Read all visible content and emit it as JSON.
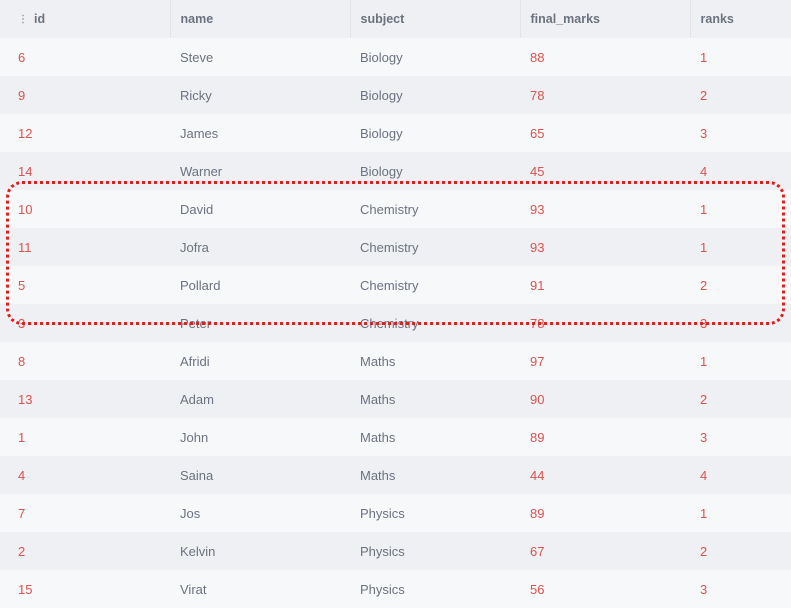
{
  "columns": {
    "id": "id",
    "name": "name",
    "subject": "subject",
    "final_marks": "final_marks",
    "ranks": "ranks"
  },
  "rows": [
    {
      "id": "6",
      "name": "Steve",
      "subject": "Biology",
      "final_marks": "88",
      "ranks": "1"
    },
    {
      "id": "9",
      "name": "Ricky",
      "subject": "Biology",
      "final_marks": "78",
      "ranks": "2"
    },
    {
      "id": "12",
      "name": "James",
      "subject": "Biology",
      "final_marks": "65",
      "ranks": "3"
    },
    {
      "id": "14",
      "name": "Warner",
      "subject": "Biology",
      "final_marks": "45",
      "ranks": "4"
    },
    {
      "id": "10",
      "name": "David",
      "subject": "Chemistry",
      "final_marks": "93",
      "ranks": "1"
    },
    {
      "id": "11",
      "name": "Jofra",
      "subject": "Chemistry",
      "final_marks": "93",
      "ranks": "1"
    },
    {
      "id": "5",
      "name": "Pollard",
      "subject": "Chemistry",
      "final_marks": "91",
      "ranks": "2"
    },
    {
      "id": "3",
      "name": "Peter",
      "subject": "Chemistry",
      "final_marks": "78",
      "ranks": "3"
    },
    {
      "id": "8",
      "name": "Afridi",
      "subject": "Maths",
      "final_marks": "97",
      "ranks": "1"
    },
    {
      "id": "13",
      "name": "Adam",
      "subject": "Maths",
      "final_marks": "90",
      "ranks": "2"
    },
    {
      "id": "1",
      "name": "John",
      "subject": "Maths",
      "final_marks": "89",
      "ranks": "3"
    },
    {
      "id": "4",
      "name": "Saina",
      "subject": "Maths",
      "final_marks": "44",
      "ranks": "4"
    },
    {
      "id": "7",
      "name": "Jos",
      "subject": "Physics",
      "final_marks": "89",
      "ranks": "1"
    },
    {
      "id": "2",
      "name": "Kelvin",
      "subject": "Physics",
      "final_marks": "67",
      "ranks": "2"
    },
    {
      "id": "15",
      "name": "Virat",
      "subject": "Physics",
      "final_marks": "56",
      "ranks": "3"
    }
  ],
  "chart_data": {
    "type": "table",
    "columns": [
      "id",
      "name",
      "subject",
      "final_marks",
      "ranks"
    ],
    "rows": [
      [
        6,
        "Steve",
        "Biology",
        88,
        1
      ],
      [
        9,
        "Ricky",
        "Biology",
        78,
        2
      ],
      [
        12,
        "James",
        "Biology",
        65,
        3
      ],
      [
        14,
        "Warner",
        "Biology",
        45,
        4
      ],
      [
        10,
        "David",
        "Chemistry",
        93,
        1
      ],
      [
        11,
        "Jofra",
        "Chemistry",
        93,
        1
      ],
      [
        5,
        "Pollard",
        "Chemistry",
        91,
        2
      ],
      [
        3,
        "Peter",
        "Chemistry",
        78,
        3
      ],
      [
        8,
        "Afridi",
        "Maths",
        97,
        1
      ],
      [
        13,
        "Adam",
        "Maths",
        90,
        2
      ],
      [
        1,
        "John",
        "Maths",
        89,
        3
      ],
      [
        4,
        "Saina",
        "Maths",
        44,
        4
      ],
      [
        7,
        "Jos",
        "Physics",
        89,
        1
      ],
      [
        2,
        "Kelvin",
        "Physics",
        67,
        2
      ],
      [
        15,
        "Virat",
        "Physics",
        56,
        3
      ]
    ],
    "highlighted_rows": [
      4,
      5,
      6,
      7
    ]
  }
}
